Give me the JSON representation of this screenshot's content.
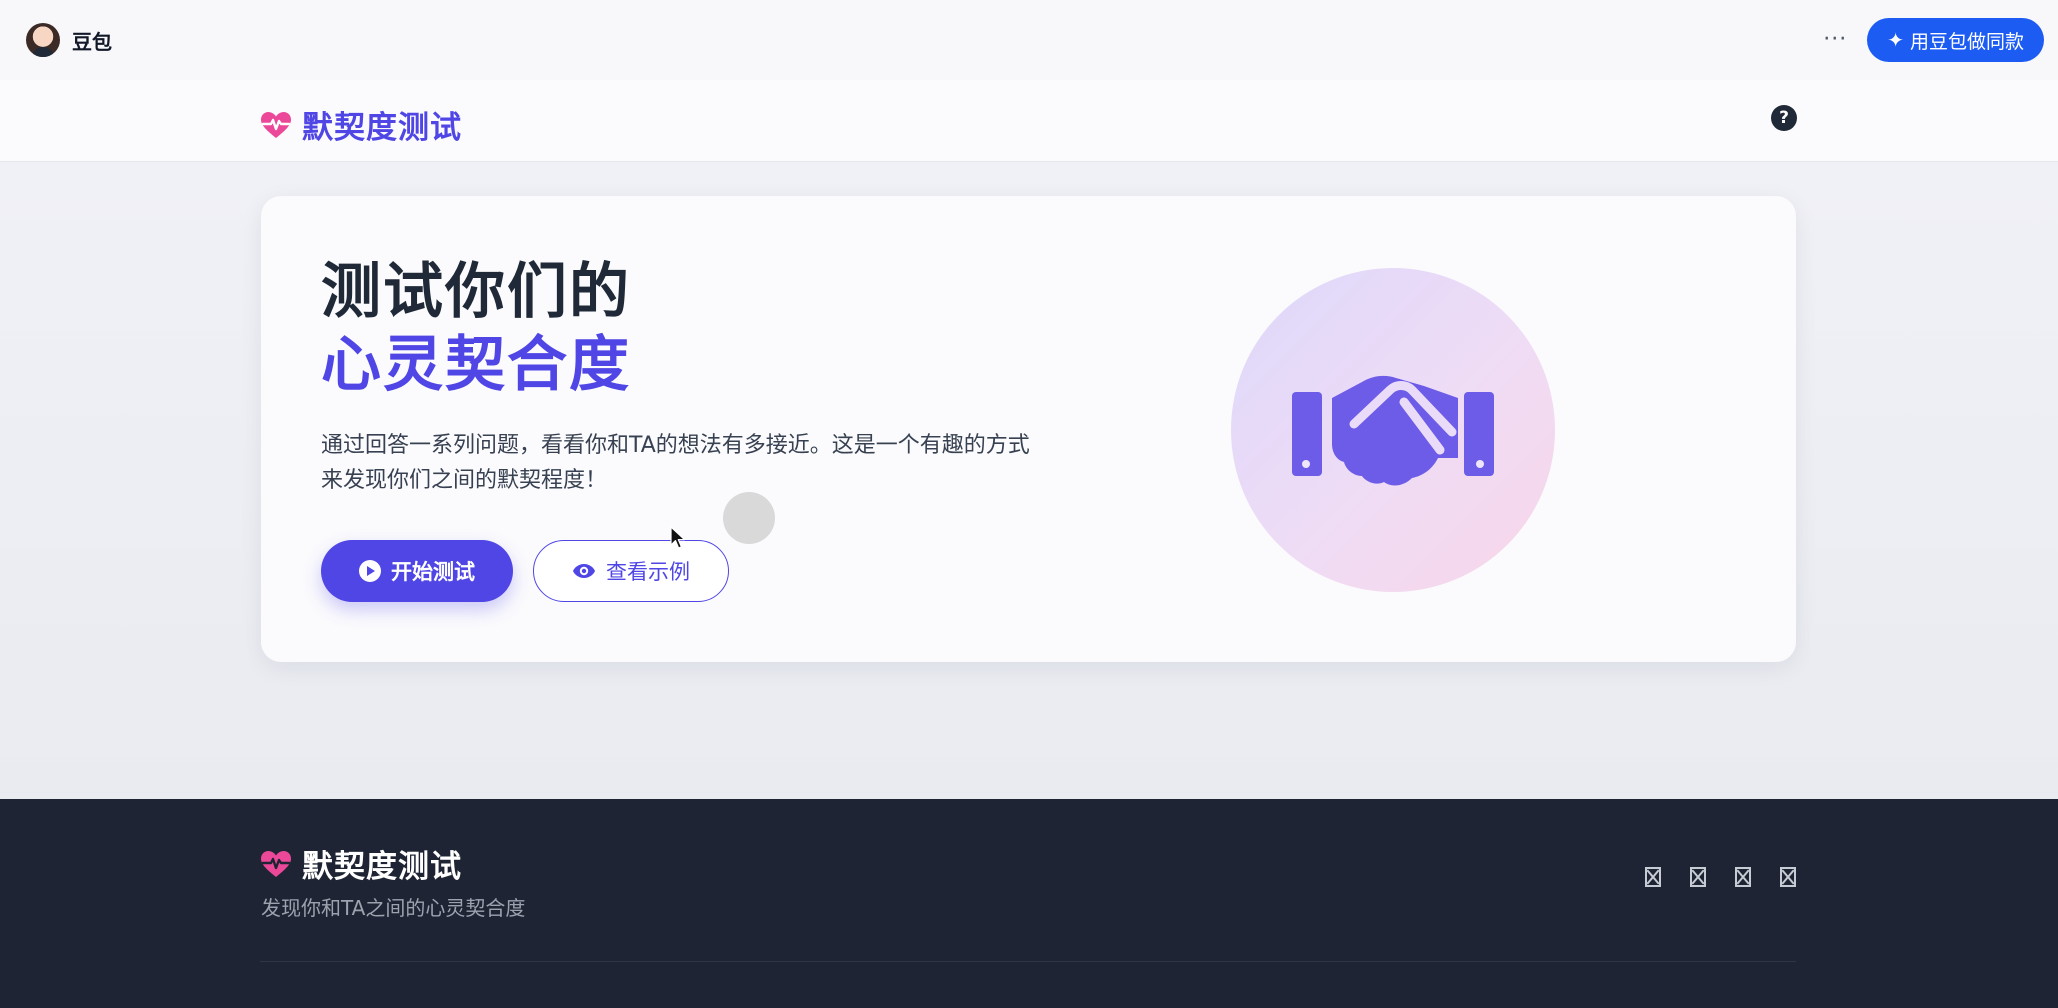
{
  "topbar": {
    "app_name": "豆包",
    "more_label": "···",
    "same_button_label": "用豆包做同款"
  },
  "header": {
    "brand_title": "默契度测试",
    "help_label": "?"
  },
  "hero": {
    "title_line1": "测试你们的",
    "title_line2": "心灵契合度",
    "description": "通过回答一系列问题，看看你和TA的想法有多接近。这是一个有趣的方式来发现你们之间的默契程度！",
    "start_button": "开始测试",
    "example_button": "查看示例",
    "illustration_icon": "handshake-icon"
  },
  "footer": {
    "brand_title": "默契度测试",
    "description": "发现你和TA之间的心灵契合度",
    "social_icons": [
      "social-icon-1",
      "social-icon-2",
      "social-icon-3",
      "social-icon-4"
    ]
  },
  "colors": {
    "accent": "#4f46e5",
    "brand_heart": "#ec4899",
    "doubao_blue": "#1d5cf2",
    "footer_bg": "#1e2433"
  }
}
